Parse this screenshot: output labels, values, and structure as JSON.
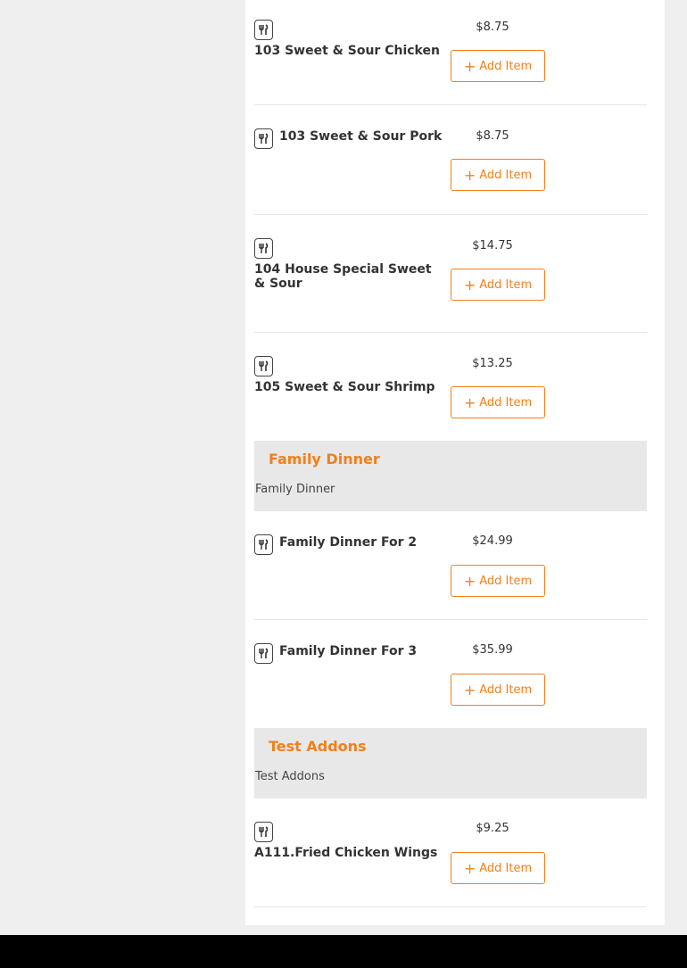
{
  "add_label": "Add Item",
  "colors": {
    "accent": "#f0801b",
    "panel_bg": "#ffffff",
    "page_bg": "#efefef",
    "category_bg": "#e8e8e8",
    "footer": "#000000"
  },
  "items": [
    {
      "name": "103 Sweet & Sour Chicken",
      "price": "$8.75",
      "icon": "fork-knife-icon"
    },
    {
      "name": "103 Sweet & Sour Pork",
      "price": "$8.75",
      "icon": "fork-knife-icon"
    },
    {
      "name": "104 House Special Sweet & Sour",
      "price": "$14.75",
      "icon": "fork-knife-icon"
    },
    {
      "name": "105 Sweet & Sour Shrimp",
      "price": "$13.25",
      "icon": "fork-knife-icon"
    }
  ],
  "categories": [
    {
      "title": "Family Dinner",
      "description": "Family Dinner",
      "items": [
        {
          "name": "Family Dinner For 2",
          "price": "$24.99",
          "icon": "fork-knife-icon"
        },
        {
          "name": "Family Dinner For 3",
          "price": "$35.99",
          "icon": "fork-knife-icon"
        }
      ]
    },
    {
      "title": "Test Addons",
      "description": "Test Addons",
      "items": [
        {
          "name": "A111.Fried Chicken Wings",
          "price": "$9.25",
          "icon": "fork-knife-icon"
        }
      ]
    }
  ]
}
